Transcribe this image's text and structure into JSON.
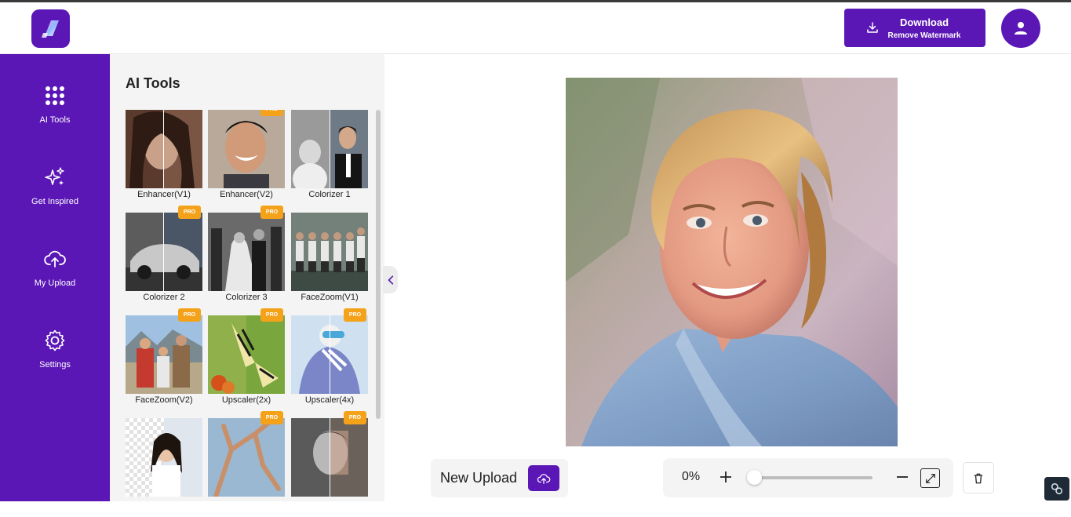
{
  "header": {
    "download_label": "Download",
    "download_sublabel": "Remove Watermark"
  },
  "sidebar": {
    "items": [
      {
        "label": "AI Tools",
        "icon": "grid-icon"
      },
      {
        "label": "Get Inspired",
        "icon": "sparkles-icon"
      },
      {
        "label": "My Upload",
        "icon": "cloud-upload-icon"
      },
      {
        "label": "Settings",
        "icon": "gear-icon"
      }
    ]
  },
  "tools_panel": {
    "title": "AI Tools",
    "pro_badge": "PRO",
    "tools": [
      {
        "label": "Enhancer(V1)",
        "pro": false
      },
      {
        "label": "Enhancer(V2)",
        "pro": true
      },
      {
        "label": "Colorizer 1",
        "pro": false
      },
      {
        "label": "Colorizer 2",
        "pro": true
      },
      {
        "label": "Colorizer 3",
        "pro": true
      },
      {
        "label": "FaceZoom(V1)",
        "pro": false
      },
      {
        "label": "FaceZoom(V2)",
        "pro": true
      },
      {
        "label": "Upscaler(2x)",
        "pro": true
      },
      {
        "label": "Upscaler(4x)",
        "pro": true
      },
      {
        "label": "",
        "pro": false
      },
      {
        "label": "",
        "pro": true
      },
      {
        "label": "",
        "pro": true
      }
    ]
  },
  "bottom": {
    "new_upload_label": "New Upload",
    "zoom_value": "0%",
    "zoom_level": 0
  },
  "colors": {
    "brand": "#5a17b6",
    "pro_badge": "#f5a21b",
    "panel_bg": "#f4f4f4"
  }
}
